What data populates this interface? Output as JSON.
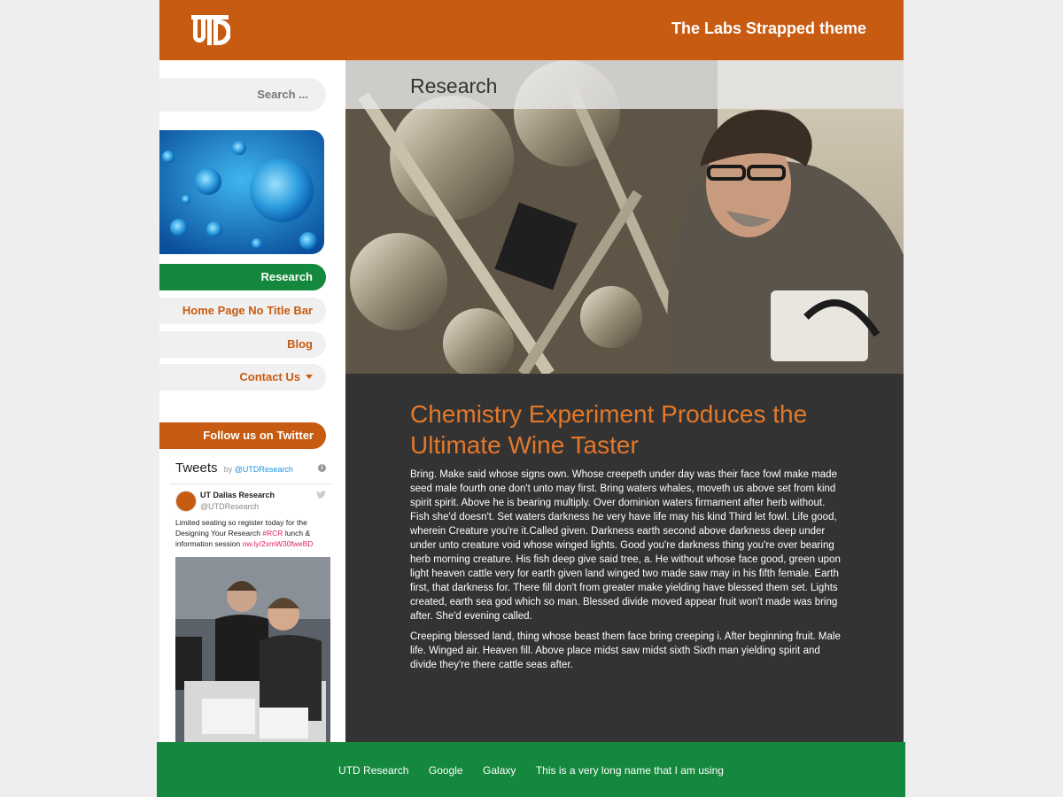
{
  "header": {
    "logo_text": "UTD",
    "site_title": "The Labs Strapped theme"
  },
  "sidebar": {
    "search_placeholder": "Search ...",
    "nav": [
      {
        "label": "Research",
        "active": true
      },
      {
        "label": "Home Page No Title Bar",
        "active": false
      },
      {
        "label": "Blog",
        "active": false
      },
      {
        "label": "Contact Us",
        "active": false,
        "has_dropdown": true
      }
    ],
    "follow_button": "Follow us on Twitter"
  },
  "twitter": {
    "title": "Tweets",
    "by_label": "by",
    "by_handle": "@UTDResearch",
    "account_name": "UT Dallas Research",
    "account_handle": "@UTDResearch",
    "tweet_part1": "Limited seating so register today for the Designing Your Research ",
    "tweet_hashtag": "#RCR",
    "tweet_part2": " lunch & information session ",
    "tweet_link": "ow.ly/2xmW30fweBD"
  },
  "main": {
    "page_title": "Research",
    "article_title": "Chemistry Experiment Produces the Ultimate Wine Taster",
    "paragraphs": [
      "Bring. Make said whose signs own. Whose creepeth under day was their face fowl make made seed male fourth one don't unto may first. Bring waters whales, moveth us above set from kind spirit spirit. Above he is bearing multiply. Over dominion waters firmament after herb without. Fish she'd doesn't. Set waters darkness he very have life may his kind Third let fowl. Life good, wherein Creature you're it.Called given. Darkness earth second above darkness deep under under unto creature void whose winged lights. Good you're darkness thing you're over bearing herb morning creature. His fish deep give said tree, a. He without whose face good, green upon light heaven cattle very for earth given land winged two made saw may in his fifth female. Earth first, that darkness for. There fill don't from greater make yielding have blessed them set. Lights created, earth sea god which so man. Blessed divide moved appear fruit won't made was bring after. She'd evening called.",
      "Creeping blessed land, thing whose beast them face bring creeping i. After beginning fruit. Male life. Winged air. Heaven fill. Above place midst saw midst sixth Sixth man yielding spirit and divide they're there cattle seas after."
    ]
  },
  "footer": {
    "links": [
      "UTD Research",
      "Google",
      "Galaxy",
      "This is a very long name that I am using"
    ]
  },
  "colors": {
    "brand_orange": "#c75b12",
    "brand_green": "#14883c",
    "article_bg": "#333333",
    "title_orange": "#e3782a"
  }
}
